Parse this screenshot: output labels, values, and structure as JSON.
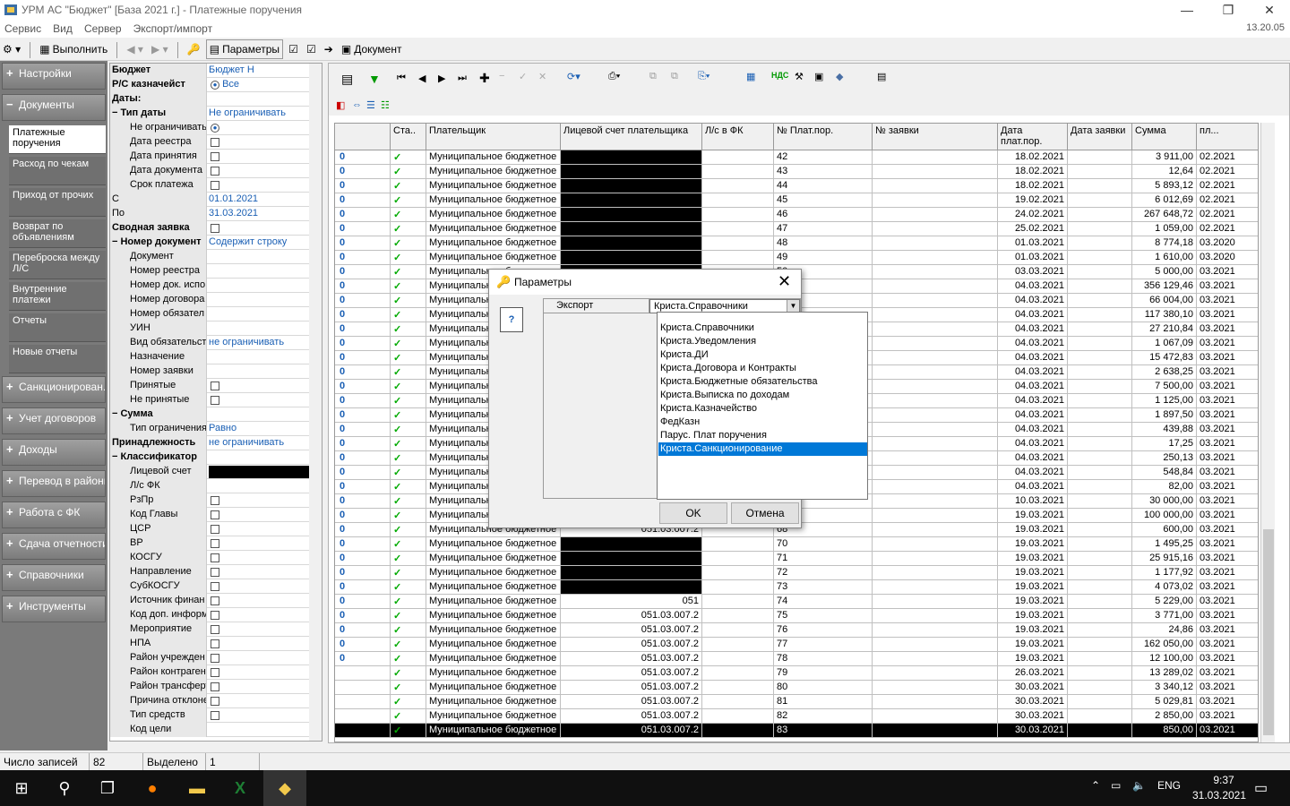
{
  "window": {
    "title": "УРМ АС \"Бюджет\" [База 2021 г.] - Платежные поручения",
    "version": "13.20.05"
  },
  "menu": [
    "Сервис",
    "Вид",
    "Сервер",
    "Экспорт/импорт"
  ],
  "toolbar": {
    "execute": "Выполнить",
    "params": "Параметры",
    "document": "Документ"
  },
  "sidebar": {
    "groups_top": [
      {
        "label": "Настройки",
        "sign": "+"
      },
      {
        "label": "Документы",
        "sign": "−"
      }
    ],
    "subitems": [
      "Платежные поручения",
      "Расход по чекам",
      "Приход от прочих",
      "Возврат по объявлениям",
      "Переброска между Л/С",
      "Внутренние платежи",
      "Отчеты",
      "Новые отчеты"
    ],
    "groups_bottom": [
      "Санкционирован...",
      "Учет договоров",
      "Доходы",
      "Перевод в районы",
      "Работа с ФК",
      "Сдача отчетности",
      "Справочники",
      "Инструменты"
    ]
  },
  "filter": [
    {
      "k": "Бюджет",
      "v": "Бюджет Н",
      "b": true,
      "t": "text"
    },
    {
      "k": "Р/С казначейст",
      "v": "Все",
      "b": true,
      "t": "radio"
    },
    {
      "k": "Даты:",
      "v": "",
      "b": true,
      "t": "none"
    },
    {
      "k": "− Тип даты",
      "v": "Не ограничивать",
      "b": true,
      "t": "text"
    },
    {
      "k": "Не ограничивать",
      "v": "",
      "t": "radio",
      "i": true
    },
    {
      "k": "Дата реестра",
      "v": "",
      "t": "check",
      "i": true
    },
    {
      "k": "Дата принятия",
      "v": "",
      "t": "check",
      "i": true
    },
    {
      "k": "Дата документа",
      "v": "",
      "t": "check",
      "i": true
    },
    {
      "k": "Срок платежа",
      "v": "",
      "t": "check",
      "i": true
    },
    {
      "k": "С",
      "v": "01.01.2021",
      "t": "text"
    },
    {
      "k": "По",
      "v": "31.03.2021",
      "t": "text"
    },
    {
      "k": "Сводная заявка",
      "v": "",
      "b": true,
      "t": "check"
    },
    {
      "k": "− Номер документ",
      "v": "Содержит строку",
      "b": true,
      "t": "text"
    },
    {
      "k": "Документ",
      "v": "",
      "t": "none",
      "i": true
    },
    {
      "k": "Номер реестра",
      "v": "",
      "t": "none",
      "i": true
    },
    {
      "k": "Номер док. испо",
      "v": "",
      "t": "none",
      "i": true
    },
    {
      "k": "Номер договора",
      "v": "",
      "t": "none",
      "i": true
    },
    {
      "k": "Номер обязател",
      "v": "",
      "t": "none",
      "i": true
    },
    {
      "k": "УИН",
      "v": "",
      "t": "none",
      "i": true
    },
    {
      "k": "Вид обязательст",
      "v": "не ограничивать",
      "t": "text",
      "i": true
    },
    {
      "k": "Назначение",
      "v": "",
      "t": "none",
      "i": true
    },
    {
      "k": "Номер заявки",
      "v": "",
      "t": "none",
      "i": true
    },
    {
      "k": "Принятые",
      "v": "",
      "t": "check",
      "i": true
    },
    {
      "k": "Не принятые",
      "v": "",
      "t": "check",
      "i": true
    },
    {
      "k": "− Сумма",
      "v": "",
      "b": true,
      "t": "none"
    },
    {
      "k": "Тип ограничения",
      "v": "Равно",
      "t": "text",
      "i": true
    },
    {
      "k": "Принадлежность",
      "v": "не ограничивать",
      "b": true,
      "t": "text"
    },
    {
      "k": "− Классификатор",
      "v": "",
      "b": true,
      "t": "none"
    },
    {
      "k": "Лицевой счет",
      "v": "",
      "t": "redact",
      "i": true
    },
    {
      "k": "Л/с ФК",
      "v": "",
      "t": "none",
      "i": true
    },
    {
      "k": "РзПр",
      "v": "",
      "t": "check",
      "i": true
    },
    {
      "k": "Код Главы",
      "v": "",
      "t": "check",
      "i": true
    },
    {
      "k": "ЦСР",
      "v": "",
      "t": "check",
      "i": true
    },
    {
      "k": "ВР",
      "v": "",
      "t": "check",
      "i": true
    },
    {
      "k": "КОСГУ",
      "v": "",
      "t": "check",
      "i": true
    },
    {
      "k": "Направление",
      "v": "",
      "t": "check",
      "i": true
    },
    {
      "k": "СубКОСГУ",
      "v": "",
      "t": "check",
      "i": true
    },
    {
      "k": "Источник финан",
      "v": "",
      "t": "check",
      "i": true
    },
    {
      "k": "Код доп. информ",
      "v": "",
      "t": "check",
      "i": true
    },
    {
      "k": "Мероприятие",
      "v": "",
      "t": "check",
      "i": true
    },
    {
      "k": "НПА",
      "v": "",
      "t": "check",
      "i": true
    },
    {
      "k": "Район учрежден",
      "v": "",
      "t": "check",
      "i": true
    },
    {
      "k": "Район контраген",
      "v": "",
      "t": "check",
      "i": true
    },
    {
      "k": "Район трансферт",
      "v": "",
      "t": "check",
      "i": true
    },
    {
      "k": "Причина отклоне",
      "v": "",
      "t": "check",
      "i": true
    },
    {
      "k": "Тип средств",
      "v": "",
      "t": "check",
      "i": true
    },
    {
      "k": "Код цели",
      "v": "",
      "t": "none",
      "i": true
    }
  ],
  "grid": {
    "headers": [
      "Ста..",
      "Плательщик",
      "Лицевой счет плательщика",
      "Л/с в ФК",
      "№ Плат.пор.",
      "№ заявки",
      "Дата плат.пор.",
      "Дата заявки",
      "Сумма",
      "пл..."
    ],
    "payer": "Муниципальное бюджетное",
    "rows": [
      [
        "",
        "42",
        "18.02.2021",
        "3 911,00",
        "02.2021"
      ],
      [
        "",
        "43",
        "18.02.2021",
        "12,64",
        "02.2021"
      ],
      [
        "",
        "44",
        "18.02.2021",
        "5 893,12",
        "02.2021"
      ],
      [
        "",
        "45",
        "19.02.2021",
        "6 012,69",
        "02.2021"
      ],
      [
        "",
        "46",
        "24.02.2021",
        "267 648,72",
        "02.2021"
      ],
      [
        "",
        "47",
        "25.02.2021",
        "1 059,00",
        "02.2021"
      ],
      [
        "",
        "48",
        "01.03.2021",
        "8 774,18",
        "03.2020"
      ],
      [
        "",
        "49",
        "01.03.2021",
        "1 610,00",
        "03.2020"
      ],
      [
        "",
        "50",
        "03.03.2021",
        "5 000,00",
        "03.2021"
      ],
      [
        "",
        "51",
        "04.03.2021",
        "356 129,46",
        "03.2021"
      ],
      [
        "",
        "52",
        "04.03.2021",
        "66 004,00",
        "03.2021"
      ],
      [
        "",
        "53",
        "04.03.2021",
        "117 380,10",
        "03.2021"
      ],
      [
        "",
        "54",
        "04.03.2021",
        "27 210,84",
        "03.2021"
      ],
      [
        "",
        "55",
        "04.03.2021",
        "1 067,09",
        "03.2021"
      ],
      [
        "",
        "56",
        "04.03.2021",
        "15 472,83",
        "03.2021"
      ],
      [
        "",
        "57",
        "04.03.2021",
        "2 638,25",
        "03.2021"
      ],
      [
        "",
        "58",
        "04.03.2021",
        "7 500,00",
        "03.2021"
      ],
      [
        "",
        "59",
        "04.03.2021",
        "1 125,00",
        "03.2021"
      ],
      [
        "",
        "60",
        "04.03.2021",
        "1 897,50",
        "03.2021"
      ],
      [
        "",
        "61",
        "04.03.2021",
        "439,88",
        "03.2021"
      ],
      [
        "",
        "62",
        "04.03.2021",
        "17,25",
        "03.2021"
      ],
      [
        "",
        "63",
        "04.03.2021",
        "250,13",
        "03.2021"
      ],
      [
        "",
        "64",
        "04.03.2021",
        "548,84",
        "03.2021"
      ],
      [
        "",
        "65",
        "04.03.2021",
        "82,00",
        "03.2021"
      ],
      [
        "",
        "66",
        "10.03.2021",
        "30 000,00",
        "03.2021"
      ],
      [
        "",
        "67",
        "19.03.2021",
        "100 000,00",
        "03.2021"
      ],
      [
        "051.03.007.2",
        "68",
        "19.03.2021",
        "600,00",
        "03.2021"
      ],
      [
        "",
        "70",
        "19.03.2021",
        "1 495,25",
        "03.2021"
      ],
      [
        "",
        "71",
        "19.03.2021",
        "25 915,16",
        "03.2021"
      ],
      [
        "",
        "72",
        "19.03.2021",
        "1 177,92",
        "03.2021"
      ],
      [
        "",
        "73",
        "19.03.2021",
        "4 073,02",
        "03.2021"
      ],
      [
        "051",
        "74",
        "19.03.2021",
        "5 229,00",
        "03.2021"
      ],
      [
        "051.03.007.2",
        "75",
        "19.03.2021",
        "3 771,00",
        "03.2021"
      ],
      [
        "051.03.007.2",
        "76",
        "19.03.2021",
        "24,86",
        "03.2021"
      ],
      [
        "051.03.007.2",
        "77",
        "19.03.2021",
        "162 050,00",
        "03.2021"
      ],
      [
        "051.03.007.2",
        "78",
        "19.03.2021",
        "12 100,00",
        "03.2021"
      ],
      [
        "051.03.007.2",
        "79",
        "26.03.2021",
        "13 289,02",
        "03.2021"
      ],
      [
        "051.03.007.2",
        "80",
        "30.03.2021",
        "3 340,12",
        "03.2021"
      ],
      [
        "051.03.007.2",
        "81",
        "30.03.2021",
        "5 029,81",
        "03.2021"
      ],
      [
        "051.03.007.2",
        "82",
        "30.03.2021",
        "2 850,00",
        "03.2021"
      ],
      [
        "051.03.007.2",
        "83",
        "30.03.2021",
        "850,00",
        "03.2021"
      ]
    ]
  },
  "dialog": {
    "title": "Параметры",
    "field_label": "Экспорт",
    "selected": "Криста.Справочники",
    "options": [
      "Криста.Справочники",
      "Криста.Уведомления",
      "Криста.ДИ",
      "Криста.Договора и Контракты",
      "Криста.Бюджетные обязательства",
      "Криста.Выписка по доходам",
      "Криста.Казначейство",
      "ФедКазн",
      "Парус. Плат поручения",
      "Криста.Санкционирование"
    ],
    "highlighted_index": 9,
    "ok": "OK",
    "cancel": "Отмена"
  },
  "status": {
    "records_label": "Число записей",
    "records": "82",
    "selected_label": "Выделено",
    "selected": "1"
  },
  "taskbar": {
    "lang": "ENG",
    "time": "9:37",
    "date": "31.03.2021"
  }
}
